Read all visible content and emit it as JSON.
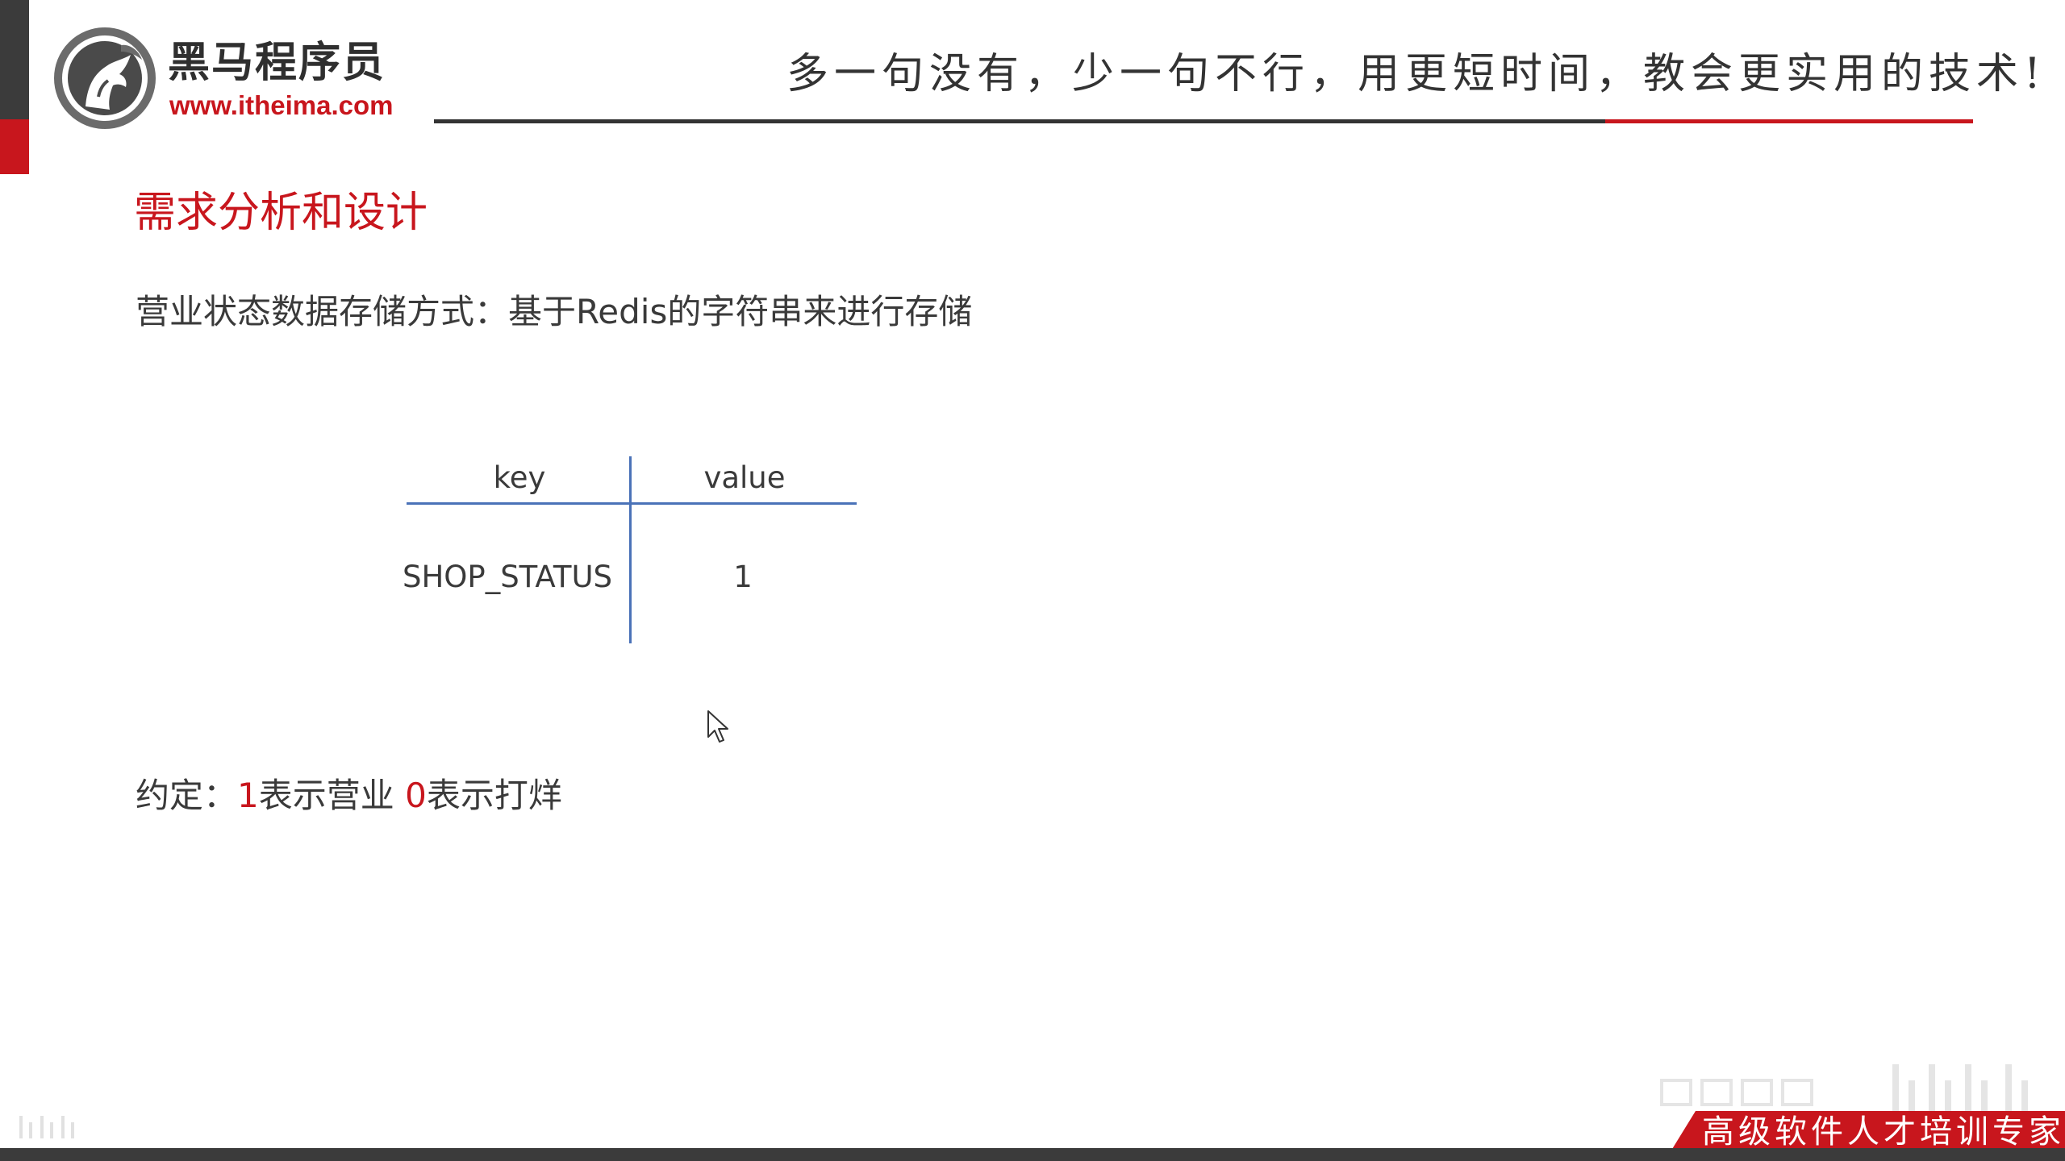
{
  "header": {
    "brand_cn": "黑马程序员",
    "brand_url": "www.itheima.com",
    "slogan": "多一句没有，少一句不行，用更短时间，教会更实用的技术!"
  },
  "slide": {
    "title": "需求分析和设计",
    "description": "营业状态数据存储方式：基于Redis的字符串来进行存储",
    "table": {
      "headers": [
        "key",
        "value"
      ],
      "rows": [
        [
          "SHOP_STATUS",
          "1"
        ]
      ]
    },
    "convention": {
      "prefix": "约定：",
      "open_value": "1",
      "open_text": "表示营业 ",
      "closed_value": "0",
      "closed_text": "表示打烊"
    }
  },
  "footer": {
    "tagline": "高级软件人才培训专家"
  },
  "colors": {
    "accent_red": "#c8161d",
    "dark": "#3b3b3b",
    "table_line": "#4a72b8"
  },
  "icons": [
    "horse-logo-icon",
    "mouse-cursor-icon",
    "bilibili-watermark-icon"
  ]
}
